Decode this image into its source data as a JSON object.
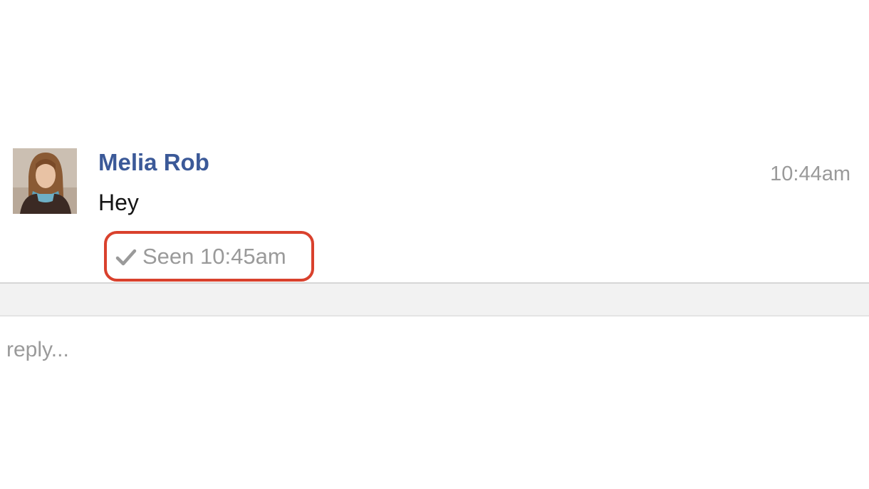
{
  "conversation": {
    "message": {
      "sender_name": "Melia Rob",
      "text": "Hey",
      "timestamp": "10:44am",
      "avatar_icon": "user-photo"
    },
    "seen_receipt": {
      "icon": "check-icon",
      "text": "Seen 10:45am",
      "highlight_color": "#d9412d"
    }
  },
  "composer": {
    "placeholder": "reply..."
  },
  "colors": {
    "sender_name": "#3b5998",
    "muted_text": "#9a9a9a"
  }
}
